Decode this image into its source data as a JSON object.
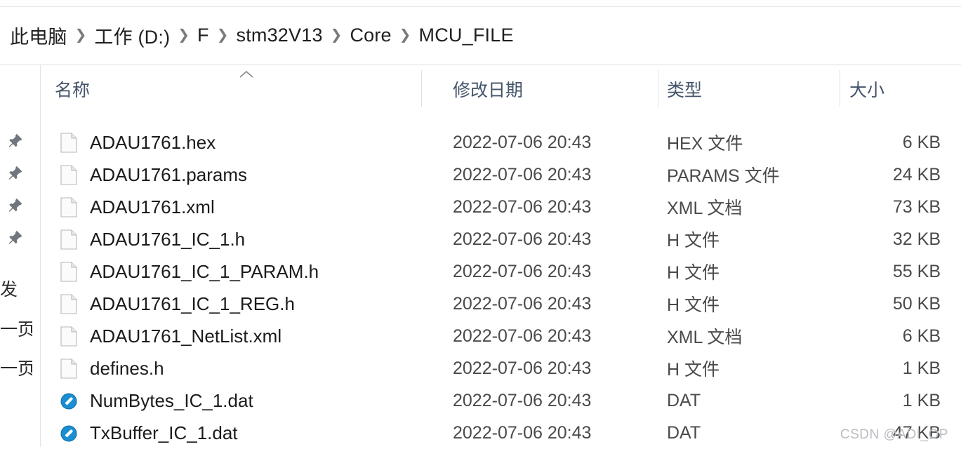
{
  "breadcrumb": {
    "separator": "❯",
    "items": [
      {
        "label": "此电脑"
      },
      {
        "label": "工作 (D:)"
      },
      {
        "label": "F"
      },
      {
        "label": "stm32V13"
      },
      {
        "label": "Core"
      },
      {
        "label": "MCU_FILE"
      }
    ]
  },
  "left_strip": {
    "pins": [
      {
        "icon": "pushpin-icon"
      },
      {
        "icon": "pushpin-icon"
      },
      {
        "icon": "pushpin-icon"
      },
      {
        "icon": "pushpin-icon"
      }
    ],
    "labels": [
      {
        "text": "发"
      },
      {
        "text": "一页"
      },
      {
        "text": "一页"
      }
    ]
  },
  "columns": {
    "name": "名称",
    "date": "修改日期",
    "type": "类型",
    "size": "大小",
    "sort_icon": "chevron-up-icon",
    "sorted_by": "名称",
    "sort_direction": "ascending"
  },
  "files": [
    {
      "name": "ADAU1761.hex",
      "date": "2022-07-06 20:43",
      "type": "HEX 文件",
      "size": "6 KB",
      "icon": "document-icon"
    },
    {
      "name": "ADAU1761.params",
      "date": "2022-07-06 20:43",
      "type": "PARAMS 文件",
      "size": "24 KB",
      "icon": "document-icon"
    },
    {
      "name": "ADAU1761.xml",
      "date": "2022-07-06 20:43",
      "type": "XML 文档",
      "size": "73 KB",
      "icon": "document-icon"
    },
    {
      "name": "ADAU1761_IC_1.h",
      "date": "2022-07-06 20:43",
      "type": "H 文件",
      "size": "32 KB",
      "icon": "document-icon"
    },
    {
      "name": "ADAU1761_IC_1_PARAM.h",
      "date": "2022-07-06 20:43",
      "type": "H 文件",
      "size": "55 KB",
      "icon": "document-icon"
    },
    {
      "name": "ADAU1761_IC_1_REG.h",
      "date": "2022-07-06 20:43",
      "type": "H 文件",
      "size": "50 KB",
      "icon": "document-icon"
    },
    {
      "name": "ADAU1761_NetList.xml",
      "date": "2022-07-06 20:43",
      "type": "XML 文档",
      "size": "6 KB",
      "icon": "document-icon"
    },
    {
      "name": "defines.h",
      "date": "2022-07-06 20:43",
      "type": "H 文件",
      "size": "1 KB",
      "icon": "document-icon"
    },
    {
      "name": "NumBytes_IC_1.dat",
      "date": "2022-07-06 20:43",
      "type": "DAT",
      "size": "1 KB",
      "icon": "dat-file-icon"
    },
    {
      "name": "TxBuffer_IC_1.dat",
      "date": "2022-07-06 20:43",
      "type": "DAT",
      "size": "47 KB",
      "icon": "dat-file-icon"
    }
  ],
  "watermark": "CSDN @ADI_OP",
  "colors": {
    "header_text": "#44546b",
    "body_text": "#1b1b1b",
    "secondary_text": "#4a4a4a",
    "divider": "#e0e0e0",
    "dat_icon_blue": "#1a8ed1",
    "watermark": "#b9bcc0"
  }
}
